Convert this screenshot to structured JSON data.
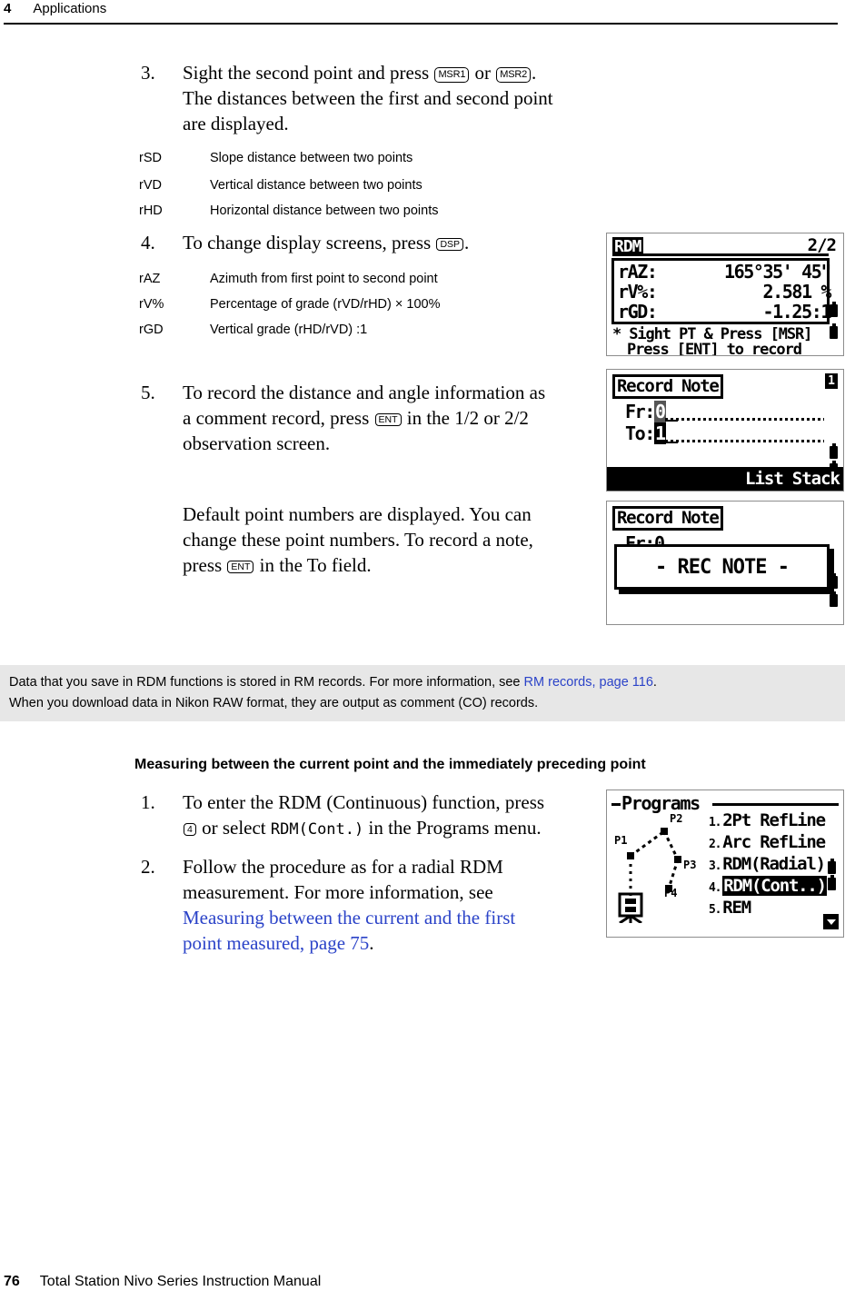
{
  "header": {
    "chapter_number": "4",
    "chapter_title": "Applications"
  },
  "footer": {
    "page_number": "76",
    "manual_title": "Total Station Nivo Series Instruction Manual"
  },
  "steps": {
    "step3": {
      "number": "3.",
      "line1_a": "Sight the second point and press",
      "key1": "MSR1",
      "line1_b": "or",
      "key2": "MSR2",
      "line1_c": ".",
      "line2": "The distances between the first and second point",
      "line3": "are displayed."
    },
    "step4": {
      "number": "4.",
      "text_a": "To change display screens, press",
      "key": "DSP",
      "text_b": "."
    },
    "step5": {
      "number": "5.",
      "line1": "To record the distance and angle information as",
      "line2_a": "a comment record, press",
      "key": "ENT",
      "line2_b": "in the 1/2 or 2/2",
      "line3": "observation screen."
    }
  },
  "paragraph_default_points": {
    "line1": "Default point numbers are displayed. You can",
    "line2": "change these point numbers. To record a note,",
    "line3_a": "press",
    "key": "ENT",
    "line3_b": "in the To field."
  },
  "definitions_distance": [
    {
      "term": "rSD",
      "desc": "Slope distance between two points"
    },
    {
      "term": "rVD",
      "desc": "Vertical distance between two points"
    },
    {
      "term": "rHD",
      "desc": "Horizontal distance between two points"
    }
  ],
  "definitions_angle": [
    {
      "term": "rAZ",
      "desc": "Azimuth from first point to second point"
    },
    {
      "term": "rV%",
      "desc": "Percentage of grade (rVD/rHD) × 100%"
    },
    {
      "term": "rGD",
      "desc": "Vertical grade (rHD/rVD) :1"
    }
  ],
  "note_band": {
    "sentence1_a": "Data that you save in RDM functions is stored in RM records. For more information, see",
    "link": "RM records, page 116",
    "sentence1_b": ".",
    "sentence2": "When you download data in Nikon RAW format, they are output as comment (CO) records.",
    "link_color": "#2b43c8",
    "background_color": "#e7e7e7"
  },
  "subheading": "Measuring between the current point and the immediately preceding point",
  "steps_continuous": {
    "step1": {
      "number": "1.",
      "line1": "To enter the RDM (Continuous) function, press",
      "key": "4",
      "line2_a": "or select",
      "menu_item": "RDM(Cont.)",
      "line2_b": "in the Programs menu."
    },
    "step2": {
      "number": "2.",
      "line1": "Follow the procedure as for a radial RDM",
      "line2": "measurement. For more information, see",
      "link_line1": "Measuring between the current and the first",
      "link_line2": "point measured, page 75",
      "trailing": "."
    }
  },
  "lcd_screen_rdm": {
    "title": "RDM",
    "page_indicator": "2/2",
    "rows": [
      {
        "label": "rAZ:",
        "value": "165°35' 45\""
      },
      {
        "label": "rV%:",
        "value": "2.581  %"
      },
      {
        "label": "rGD:",
        "value": "-1.25:1"
      }
    ],
    "message_line1": "* Sight PT & Press [MSR]",
    "message_line2": "Press [ENT] to record"
  },
  "lcd_screen_record_note_1": {
    "title": "Record Note",
    "corner_badge": "1",
    "field_from_label": "Fr:",
    "field_from_value": "0",
    "field_to_label": "To:",
    "field_to_value": "1",
    "softkey_list": "List",
    "softkey_stack": "Stack"
  },
  "lcd_screen_record_note_2": {
    "title": "Record Note",
    "field_from_label": "Fr:",
    "field_from_value": "0",
    "dialog_text": "- REC NOTE -"
  },
  "lcd_screen_programs": {
    "title": "Programs",
    "items": [
      {
        "index": "1.",
        "label": "2Pt RefLine",
        "selected": false
      },
      {
        "index": "2.",
        "label": "Arc RefLine",
        "selected": false
      },
      {
        "index": "3.",
        "label": "RDM(Radial)",
        "selected": false
      },
      {
        "index": "4.",
        "label": "RDM(Cont..)",
        "selected": true
      },
      {
        "index": "5.",
        "label": "REM",
        "selected": false
      }
    ],
    "diagram_labels": [
      "P1",
      "P2",
      "P3",
      "P4"
    ]
  }
}
